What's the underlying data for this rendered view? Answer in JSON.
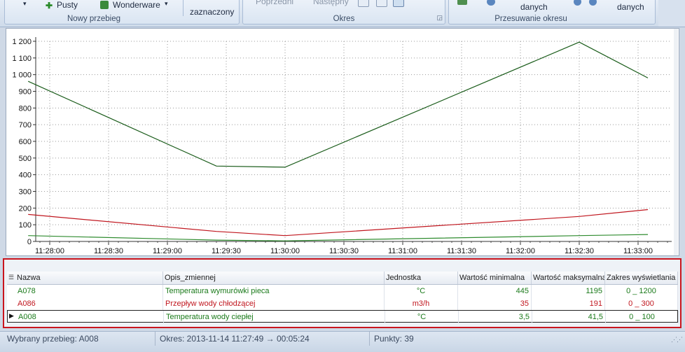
{
  "ribbon": {
    "groups": [
      {
        "title": "Nowy przebieg",
        "items": {
          "pusty": "Pusty",
          "wonderware": "Wonderware"
        }
      },
      {
        "title": "",
        "items": {
          "zaznaczony": "zaznaczony"
        }
      },
      {
        "title": "Okres",
        "items": {
          "poprzedni": "Poprzedni",
          "nastepny": "Następny"
        }
      },
      {
        "title": "Przesuwanie okresu",
        "items": {
          "danych1": "danych",
          "danych2": "danych"
        }
      }
    ]
  },
  "chart_data": {
    "type": "line",
    "x": [
      "11:27:49",
      "11:29:25",
      "11:30:00",
      "11:32:30",
      "11:33:05"
    ],
    "xticks": [
      "11:28:00",
      "11:28:30",
      "11:29:00",
      "11:29:30",
      "11:30:00",
      "11:30:30",
      "11:31:00",
      "11:31:30",
      "11:32:00",
      "11:32:30",
      "11:33:00"
    ],
    "yticks": [
      "0",
      "100",
      "200",
      "300",
      "400",
      "500",
      "600",
      "700",
      "800",
      "900",
      "1 000",
      "1 100",
      "1 200"
    ],
    "ylim": [
      0,
      1200
    ],
    "grid": true,
    "series": [
      {
        "name": "A078",
        "color": "#1a5c1a",
        "values": [
          960,
          452,
          445,
          1195,
          980
        ]
      },
      {
        "name": "A086",
        "color": "#c0161e",
        "values": [
          162,
          60,
          35,
          150,
          191
        ]
      },
      {
        "name": "A008",
        "color": "#2e8b2e",
        "values": [
          35,
          8,
          3.5,
          35,
          41.5
        ]
      }
    ]
  },
  "table": {
    "columns": [
      "Nazwa",
      "Opis_zmiennej",
      "Jednostka",
      "Wartość minimalna",
      "Wartość maksymalna",
      "Zakres wyświetlania"
    ],
    "rows": [
      {
        "name": "A078",
        "desc": "Temperatura wymurówki pieca",
        "unit": "°C",
        "min": "445",
        "max": "1195",
        "range": "0 _ 1200",
        "color": "#1a7a1a",
        "selected": false
      },
      {
        "name": "A086",
        "desc": "Przepływ wody chłodzącej",
        "unit": "m3/h",
        "min": "35",
        "max": "191",
        "range": "0 _ 300",
        "color": "#c0161e",
        "selected": false
      },
      {
        "name": "A008",
        "desc": "Temperatura wody ciepłej",
        "unit": "°C",
        "min": "3,5",
        "max": "41,5",
        "range": "0 _ 100",
        "color": "#1a7a1a",
        "selected": true
      }
    ]
  },
  "status": {
    "selected": "Wybrany przebieg: A008",
    "period": "Okres: 2013-11-14  11:27:49 → 00:05:24",
    "points": "Punkty: 39"
  }
}
